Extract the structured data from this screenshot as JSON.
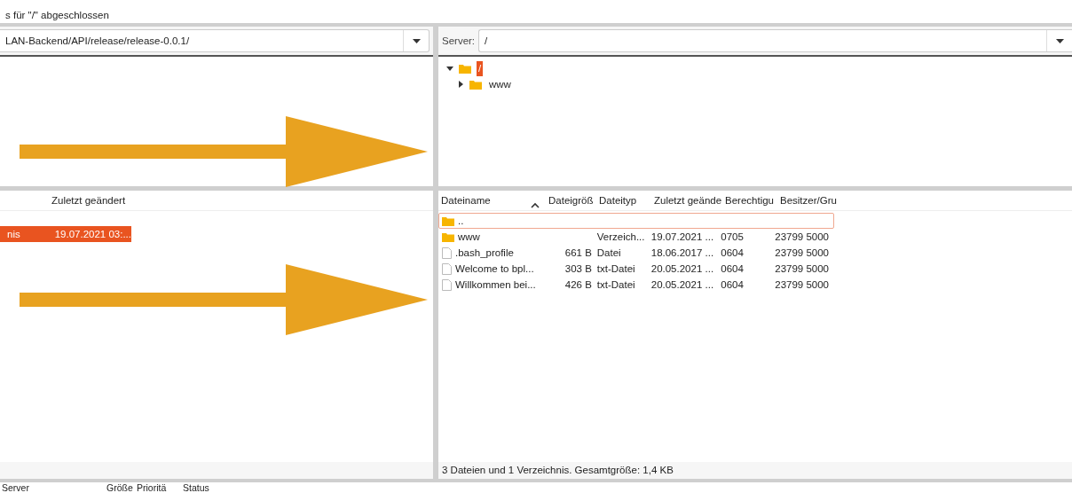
{
  "status_line": "s für \"/\" abgeschlossen",
  "local": {
    "path": "LAN-Backend/API/release/release-0.0.1/",
    "columns": [
      "",
      "Zuletzt geändert"
    ],
    "rows": [
      {
        "cells": [
          "nis",
          "19.07.2021 03:..."
        ],
        "selected": true
      }
    ]
  },
  "remote": {
    "server_label": "Server:",
    "path": "/",
    "tree": [
      {
        "name": "/",
        "selected": true,
        "expanded": true,
        "children": [
          {
            "name": "www",
            "selected": false,
            "expanded": false
          }
        ]
      }
    ],
    "columns": [
      {
        "label": "Dateiname",
        "sorted": true
      },
      {
        "label": "Dateigröß",
        "sorted": false
      },
      {
        "label": "Dateityp",
        "sorted": false
      },
      {
        "label": "Zuletzt geände",
        "sorted": false
      },
      {
        "label": "Berechtigu",
        "sorted": false
      },
      {
        "label": "Besitzer/Gru",
        "sorted": false
      }
    ],
    "rows": [
      {
        "kind": "folder",
        "cells": [
          "..",
          "",
          "",
          "",
          "",
          ""
        ],
        "selected": true
      },
      {
        "kind": "folder",
        "cells": [
          "www",
          "",
          "Verzeich...",
          "19.07.2021 ...",
          "0705",
          "23799 5000"
        ],
        "selected": false
      },
      {
        "kind": "file",
        "cells": [
          ".bash_profile",
          "661 B",
          "Datei",
          "18.06.2017 ...",
          "0604",
          "23799 5000"
        ],
        "selected": false
      },
      {
        "kind": "file",
        "cells": [
          "Welcome to bpl...",
          "303 B",
          "txt-Datei",
          "20.05.2021 ...",
          "0604",
          "23799 5000"
        ],
        "selected": false
      },
      {
        "kind": "file",
        "cells": [
          "Willkommen bei...",
          "426 B",
          "txt-Datei",
          "20.05.2021 ...",
          "0604",
          "23799 5000"
        ],
        "selected": false
      }
    ],
    "summary": "3 Dateien und 1 Verzeichnis. Gesamtgröße: 1,4 KB"
  },
  "queue": {
    "columns": [
      "Server",
      "Größe",
      "Prioritä",
      "Status"
    ]
  }
}
